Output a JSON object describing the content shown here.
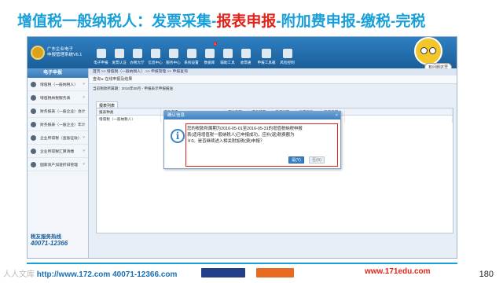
{
  "slide": {
    "title_part1": "增值税一般纳税人：发票采集-",
    "title_part2": "报表申报",
    "title_part3": "-附加费申报-缴税-完税",
    "page_number": "180"
  },
  "app": {
    "logo_line1": "广东企业电子",
    "logo_line2": "申报管理系统V6.1",
    "nav": [
      {
        "label": "电子申报"
      },
      {
        "label": "发票认证"
      },
      {
        "label": "办税大厅"
      },
      {
        "label": "信息中心"
      },
      {
        "label": "服务中心"
      },
      {
        "label": "系统设置"
      },
      {
        "label": "数据库",
        "badge": "1"
      },
      {
        "label": "辅助工具"
      },
      {
        "label": "收票通"
      },
      {
        "label": "申报工具箱"
      },
      {
        "label": "风险控制"
      }
    ],
    "mascot_label": "有问题这里",
    "sidebar": {
      "header": "电子申报",
      "items": [
        {
          "label": "增值税（一般纳税人）"
        },
        {
          "label": "增值税纳税服务表"
        },
        {
          "label": "财务报表（一般企业）会计"
        },
        {
          "label": "财务报表（一般企业）年计"
        },
        {
          "label": "企业所得税（查账征收）"
        },
        {
          "label": "企业所得税汇算清缴"
        },
        {
          "label": "国家资产加速折旧管理"
        }
      ],
      "hotline_title": "税友服务热线",
      "hotline_number": "40071-12366"
    },
    "breadcrumb": "首页 >> 增值税（一般纳税人） >> 申报管理 >> 申报查询",
    "toolbar": "查询   ▸   在线申报及结果",
    "notice": "当前税款所属期：2016年05月 - 申报表示申报报送",
    "tab": "报表列表",
    "table": {
      "headers": [
        "报表种类",
        "报表名称",
        "应纳税额",
        "报表日期",
        "申报状态",
        "详细信息",
        "要报反馈",
        ""
      ],
      "rows": [
        [
          "增值税（一般纳税人）",
          "",
          "",
          "",
          "",
          "",
          "",
          ""
        ]
      ]
    },
    "dialog": {
      "title": "确认信息",
      "icon": "info-icon",
      "message": "您的税款所属期为2016-05-01至2016-05-31的增值税纳税申报表(适用增值税一般纳税人)已申报成功，应补(退)税费额为￥0。是否继续进入相关附加税(费)申报？",
      "yes_label": "是(Y)",
      "no_label": "否(N)"
    }
  },
  "footer": {
    "left_text": "http://www.172.com 40071-12366.com",
    "left_watermark": "人人文库",
    "right_text": "www.171edu.com"
  },
  "colors": {
    "title_blue": "#1aa0d8",
    "title_red": "#e2231a",
    "app_blue": "#1b5e99"
  }
}
